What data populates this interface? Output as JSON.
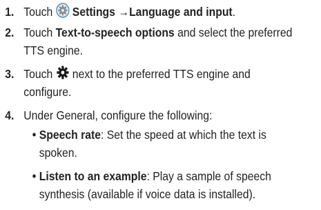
{
  "steps": [
    {
      "number": "1.",
      "line1": {
        "pre": "Touch",
        "icon": "gear-icon",
        "bold": "Settings →Language and input",
        "post": "."
      }
    },
    {
      "number": "2.",
      "line1": {
        "pre": "Touch ",
        "bold": "Text-to-speech options",
        "post": " and select the preferred"
      },
      "line2": "TTS engine."
    },
    {
      "number": "3.",
      "line1": {
        "pre": "Touch",
        "icon": "settings-cog-icon",
        "post": "next to the preferred TTS engine and"
      },
      "line2": "configure."
    },
    {
      "number": "4.",
      "line1": "Under General, configure the following:",
      "bullets": [
        {
          "marker": "•",
          "title": "Speech rate",
          "line1_rest": ": Set the speed at which the text is",
          "line2": "spoken."
        },
        {
          "marker": "•",
          "title": "Listen to an example",
          "line1_rest": ": Play a sample of speech",
          "line2": "synthesis (available if voice data is installed)."
        }
      ]
    }
  ],
  "colors": {
    "text": "#222222",
    "icon_blue_ring": "#4a90c8",
    "icon_gray": "#9a9a9a",
    "icon_dark": "#1a1a1a"
  }
}
